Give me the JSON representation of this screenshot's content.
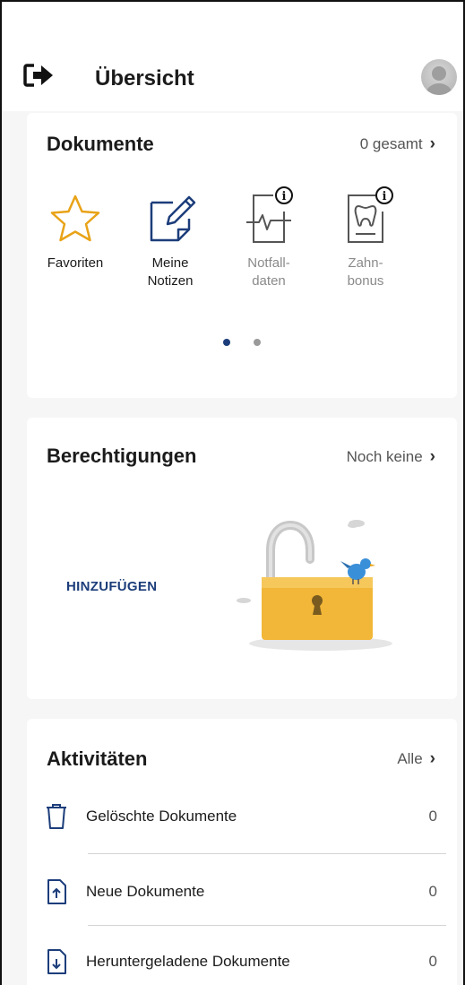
{
  "header": {
    "title": "Übersicht",
    "logout_icon": "logout-icon",
    "avatar_icon": "user-avatar"
  },
  "documents": {
    "title": "Dokumente",
    "link": "0 gesamt",
    "tiles": [
      {
        "line1": "Favoriten",
        "line2": "",
        "icon": "star-icon",
        "enabled": true
      },
      {
        "line1": "Meine",
        "line2": "Notizen",
        "icon": "note-pencil-icon",
        "enabled": true
      },
      {
        "line1": "Notfall-",
        "line2": "daten",
        "icon": "emergency-data-icon",
        "enabled": false
      },
      {
        "line1": "Zahn-",
        "line2": "bonus",
        "icon": "tooth-icon",
        "enabled": false
      }
    ],
    "pager": {
      "pages": 2,
      "active": 1
    }
  },
  "permissions": {
    "title": "Berechtigungen",
    "link": "Noch keine",
    "add_button": "HINZUFÜGEN",
    "illustration": "open-padlock-with-bird"
  },
  "activities": {
    "title": "Aktivitäten",
    "link": "Alle",
    "items": [
      {
        "label": "Gelöschte Dokumente",
        "count": "0",
        "icon": "trash-icon"
      },
      {
        "label": "Neue Dokumente",
        "count": "0",
        "icon": "upload-document-icon"
      },
      {
        "label": "Heruntergeladene Dokumente",
        "count": "0",
        "icon": "download-document-icon"
      }
    ]
  },
  "colors": {
    "accent": "#1c3d7a",
    "star": "#e8a317",
    "padlock": "#f2b738",
    "bird": "#3a8fd9",
    "background": "#f6f6f6"
  }
}
